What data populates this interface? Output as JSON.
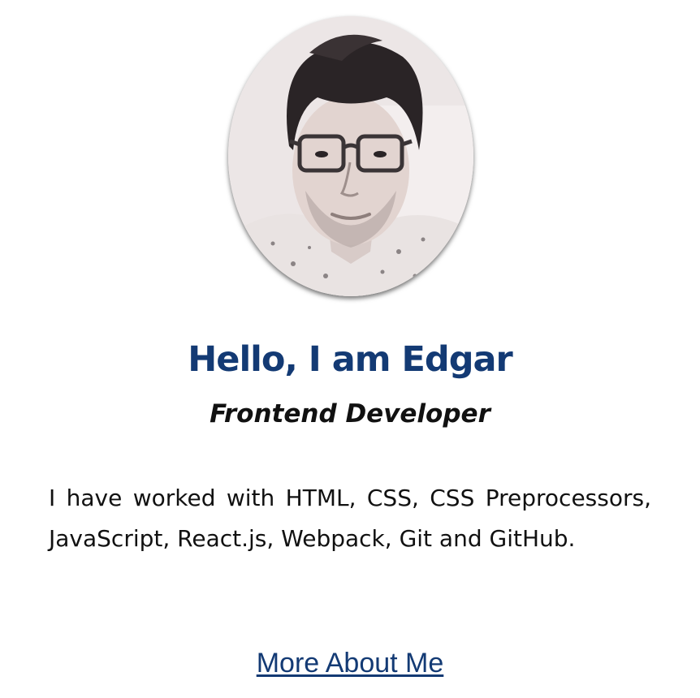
{
  "profile": {
    "greeting": "Hello, I am Edgar",
    "role": "Frontend Developer",
    "bio": "I have worked with HTML, CSS, CSS Preprocessors, JavaScript, React.js, Webpack, Git and GitHub.",
    "more_link": "More About Me"
  },
  "colors": {
    "accent": "#133a74",
    "text": "#111111",
    "background": "#ffffff"
  }
}
